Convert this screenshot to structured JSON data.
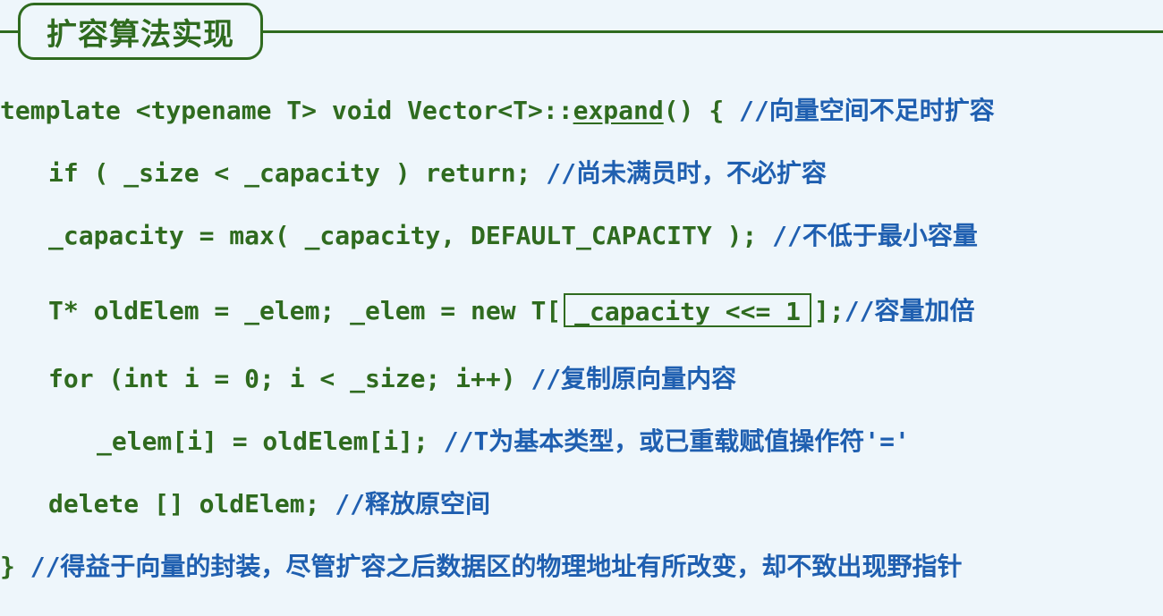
{
  "title": "扩容算法实现",
  "code": {
    "line1": {
      "pre": "template <typename T> void Vector<T>::",
      "func": "expand",
      "post": "() { ",
      "comment": "//向量空间不足时扩容"
    },
    "line2": {
      "code": "if ( _size < _capacity ) return; ",
      "comment": "//尚未满员时，不必扩容"
    },
    "line3": {
      "code": "_capacity = max( _capacity, DEFAULT_CAPACITY ); ",
      "comment": "//不低于最小容量"
    },
    "line4": {
      "pre": "T* oldElem = _elem; _elem = new T[",
      "boxed": "_capacity <<= 1",
      "post": "];",
      "comment": "//容量加倍"
    },
    "line5": {
      "code": "for (int i = 0; i < _size; i++) ",
      "comment": "//复制原向量内容"
    },
    "line6": {
      "code": "_elem[i] = oldElem[i]; ",
      "comment": "//T为基本类型，或已重载赋值操作符'='"
    },
    "line7": {
      "code": "delete [] oldElem; ",
      "comment": "//释放原空间"
    },
    "line8": {
      "code": "} ",
      "comment": "//得益于向量的封装，尽管扩容之后数据区的物理地址有所改变，却不致出现野指针"
    }
  },
  "colors": {
    "code": "#2f6b1f",
    "comment": "#1f5fb0",
    "background": "#eef6fb"
  }
}
